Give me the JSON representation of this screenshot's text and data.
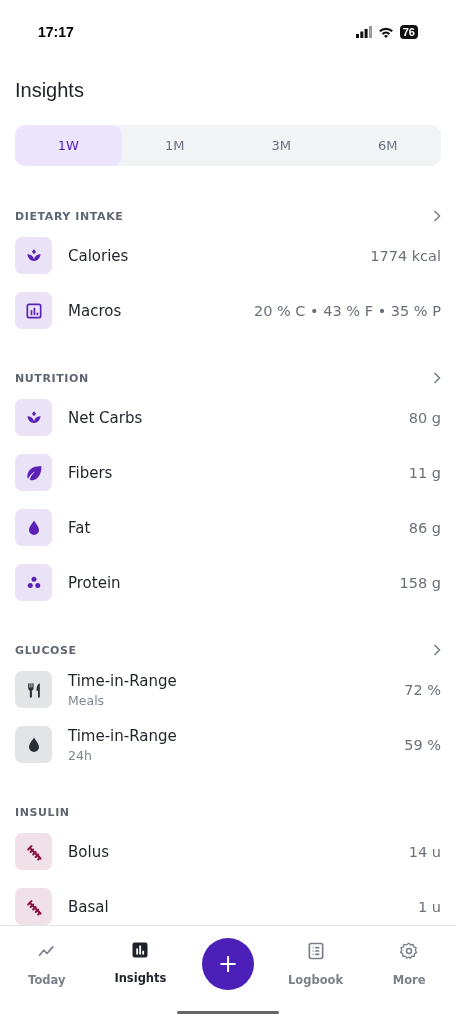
{
  "status_bar": {
    "time": "17:17",
    "battery": "76"
  },
  "title": "Insights",
  "periods": [
    {
      "label": "1W",
      "selected": true
    },
    {
      "label": "1M",
      "selected": false
    },
    {
      "label": "3M",
      "selected": false
    },
    {
      "label": "6M",
      "selected": false
    }
  ],
  "sections": [
    {
      "title": "DIETARY INTAKE",
      "link": true,
      "rows": [
        {
          "kind": "sprout",
          "color": "#5b21b6",
          "label": "Calories",
          "value": "1774 kcal"
        },
        {
          "kind": "chart",
          "color": "#5b21b6",
          "label": "Macros",
          "value": "20 % C • 43 % F • 35 % P"
        }
      ]
    },
    {
      "title": "NUTRITION",
      "link": true,
      "rows": [
        {
          "kind": "sprout",
          "color": "#5b21b6",
          "label": "Net Carbs",
          "value": "80 g"
        },
        {
          "kind": "leaf",
          "color": "#5b21b6",
          "label": "Fibers",
          "value": "11 g"
        },
        {
          "kind": "drop",
          "color": "#5b21b6",
          "label": "Fat",
          "value": "86 g"
        },
        {
          "kind": "dots",
          "color": "#5b21b6",
          "label": "Protein",
          "value": "158 g"
        }
      ]
    },
    {
      "title": "GLUCOSE",
      "link": true,
      "rows": [
        {
          "kind": "cutlery",
          "color": "#2b2f36",
          "label": "Time-in-Range",
          "sublabel": "Meals",
          "value": "72 %"
        },
        {
          "kind": "drop",
          "color": "#2b2f36",
          "label": "Time-in-Range",
          "sublabel": "24h",
          "value": "59 %"
        }
      ]
    },
    {
      "title": "INSULIN",
      "link": false,
      "rows": [
        {
          "kind": "syringe",
          "color": "#8a1343",
          "label": "Bolus",
          "value": "14 u"
        },
        {
          "kind": "syringe",
          "color": "#8a1343",
          "label": "Basal",
          "value": "1 u"
        }
      ]
    }
  ],
  "nav": [
    {
      "kind": "trend",
      "label": "Today",
      "selected": false
    },
    {
      "kind": "chart",
      "label": "Insights",
      "selected": true
    },
    {
      "kind": "add",
      "label": "+"
    },
    {
      "kind": "list",
      "label": "Logbook",
      "selected": false
    },
    {
      "kind": "gear",
      "label": "More",
      "selected": false
    }
  ]
}
